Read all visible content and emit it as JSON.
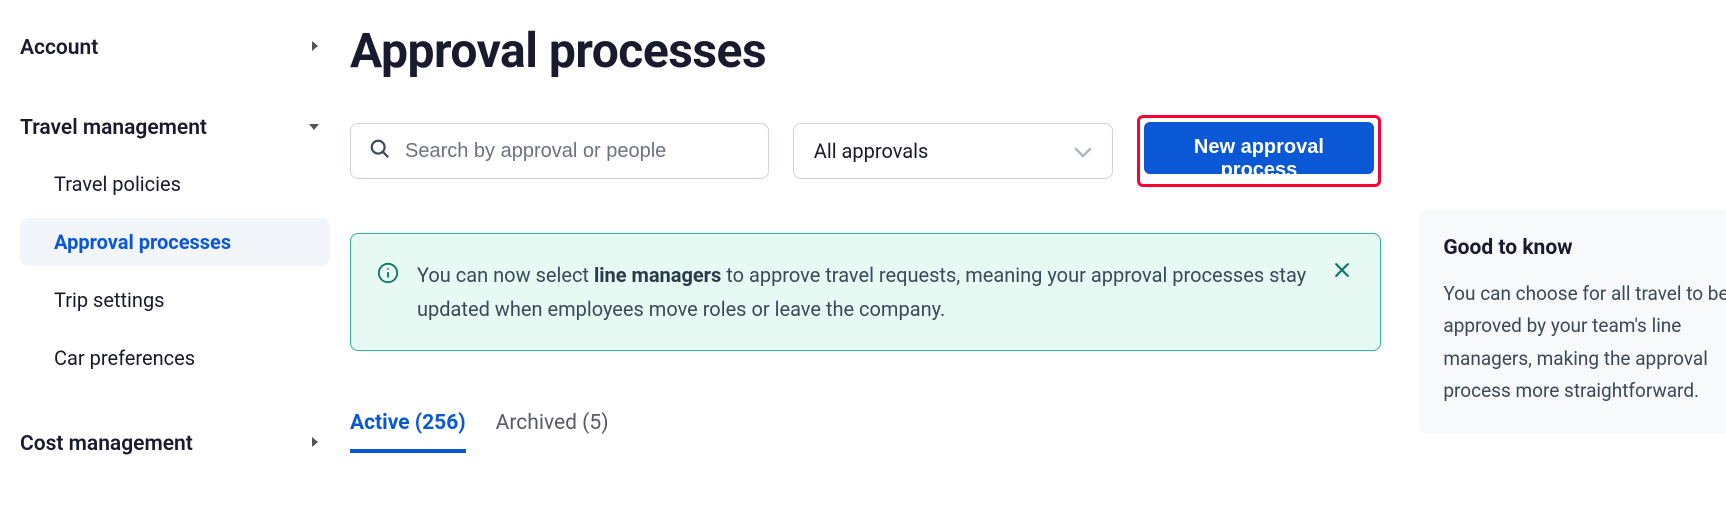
{
  "sidebar": {
    "sections": [
      {
        "label": "Account",
        "expanded": false
      },
      {
        "label": "Travel management",
        "expanded": true,
        "items": [
          {
            "label": "Travel policies",
            "active": false
          },
          {
            "label": "Approval processes",
            "active": true
          },
          {
            "label": "Trip settings",
            "active": false
          },
          {
            "label": "Car preferences",
            "active": false
          }
        ]
      },
      {
        "label": "Cost management",
        "expanded": false
      }
    ]
  },
  "page": {
    "title": "Approval processes"
  },
  "controls": {
    "search_placeholder": "Search by approval or people",
    "filter_selected": "All approvals",
    "primary_button": "New approval process"
  },
  "banner": {
    "text_prefix": "You can now select ",
    "text_bold": "line managers",
    "text_suffix": " to approve travel requests, meaning your approval processes stay updated when employees move roles or leave the company."
  },
  "tabs": {
    "active": {
      "label": "Active",
      "count": "256"
    },
    "archived": {
      "label": "Archived",
      "count": "5"
    }
  },
  "aside": {
    "title": "Good to know",
    "body": "You can choose for all travel to be approved by your team's line managers, making the approval process more straightforward."
  }
}
